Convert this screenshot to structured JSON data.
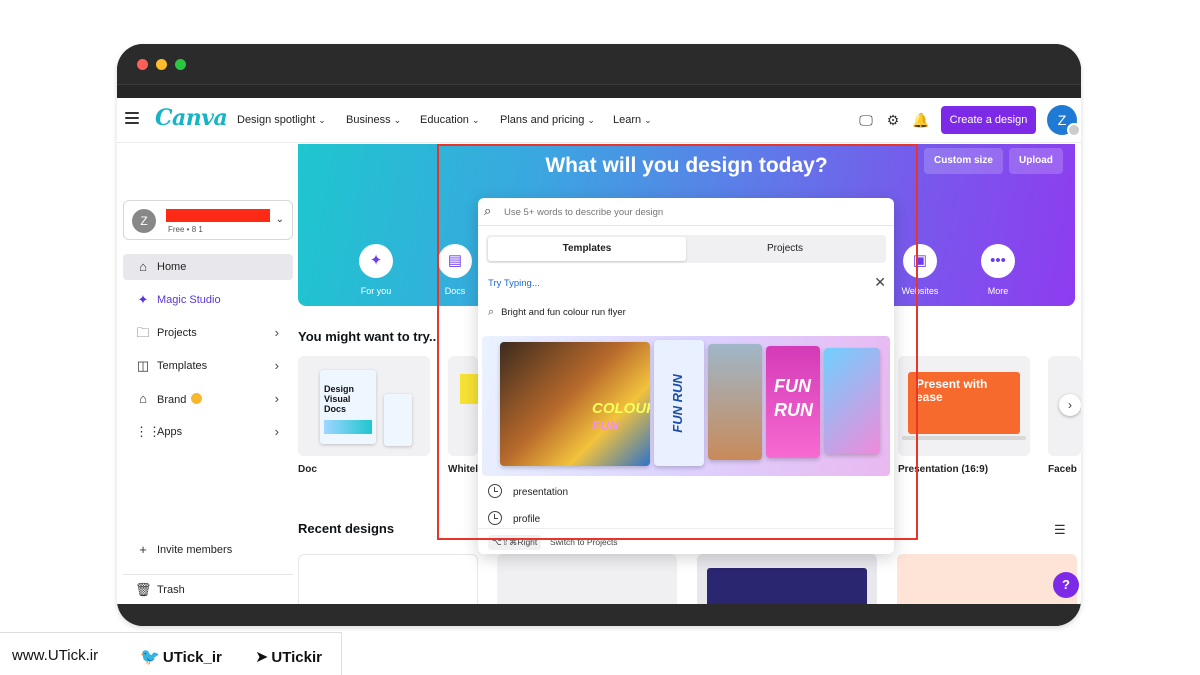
{
  "nav": {
    "logo": "Canva",
    "items": [
      "Design spotlight",
      "Business",
      "Education",
      "Plans and pricing",
      "Learn"
    ],
    "create_label": "Create a design",
    "avatar_letter": "Z"
  },
  "sidebar": {
    "team_avatar": "Z",
    "team_plan": "Free • 8 1",
    "items": [
      {
        "label": "Home"
      },
      {
        "label": "Magic Studio"
      },
      {
        "label": "Projects"
      },
      {
        "label": "Templates"
      },
      {
        "label": "Brand"
      },
      {
        "label": "Apps"
      }
    ],
    "invite_label": "Invite members",
    "trash_label": "Trash"
  },
  "hero": {
    "title": "What will you design today?",
    "custom_size": "Custom size",
    "upload": "Upload",
    "quick": [
      "For you",
      "Docs",
      "Websites",
      "More"
    ]
  },
  "search": {
    "placeholder": "Use 5+ words to describe your design",
    "tabs": [
      "Templates",
      "Projects"
    ],
    "try_typing": "Try Typing...",
    "suggestion": "Bright and fun colour run flyer",
    "promo_texts": [
      "COLOUR",
      "FUN",
      "FUN RUN",
      "FUN",
      "RUN"
    ],
    "recent": [
      "presentation",
      "profile"
    ],
    "hint_key": "⌥⇧⌘Right",
    "hint_text": "Switch to Projects"
  },
  "content": {
    "try_title": "You might want to try...",
    "cards": [
      "Doc",
      "Whitel",
      "Presentation (16:9)",
      "Faceb"
    ],
    "doc_thumb": "Design Visual Docs",
    "pres_thumb": "Present with ease",
    "recent_title": "Recent designs"
  },
  "footer": {
    "site": "www.UTick.ir",
    "twitter": "UTick_ir",
    "telegram": "UTickir"
  }
}
